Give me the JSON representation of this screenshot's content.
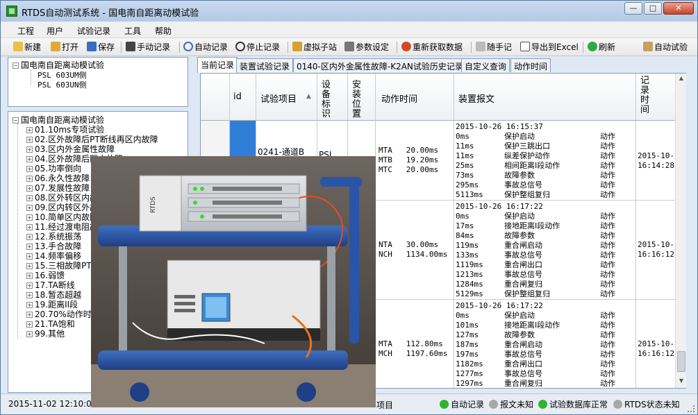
{
  "window": {
    "title": "RTDS自动测试系统 - 国电南自距离动模试验",
    "buttons": [
      "—",
      "□",
      "✕"
    ]
  },
  "menu": [
    "工程",
    "用户",
    "试验记录",
    "工具",
    "帮助"
  ],
  "toolbar": {
    "new": "新建",
    "open": "打开",
    "save": "保存",
    "manual_record": "手动记录",
    "auto_record": "自动记录",
    "stop_record": "停止记录",
    "virtual_station": "虚拟子站",
    "param_settings": "参数设定",
    "refetch_data": "重新获取数据",
    "notes": "随手记",
    "export_excel": "导出到Excel",
    "refresh": "刷新",
    "auto_test": "自动试验"
  },
  "project_tree": {
    "root": "国电南自距离动模试验",
    "children": [
      "PSL 603UM侧",
      "PSL 603UN侧"
    ]
  },
  "test_tree": {
    "root": "国电南自距离动模试验",
    "items": [
      "01.10ms专项试验",
      "02.区外故障后PT断线再区内故障",
      "03.区内外金属性故障",
      "04.区外故障后区内故障",
      "05.功率倒向",
      "06.永久性故障",
      "07.发展性故障",
      "08.区外转区内故障",
      "09.区内转区外故障",
      "10.简单区内故障",
      "11.经过渡电阻故障",
      "12.系统振荡",
      "13.手合故障",
      "14.频率偏移",
      "15.三相故障PT断线",
      "16.弱馈",
      "17.TA断线",
      "18.暂态超越",
      "19.距离II段",
      "20.70%动作时间",
      "21.TA饱和",
      "99.其他"
    ]
  },
  "tabs": [
    "当前记录",
    "装置试验记录",
    "0140-区内外金属性故障-K2AN试验历史记录",
    "自定义查询",
    "动作时间"
  ],
  "grid": {
    "headers": {
      "id": "id",
      "test_item": "试验项目",
      "device_id": "设备标识",
      "install_pos": "安装位置",
      "action_time": "动作时间",
      "device_msg": "装置报文",
      "record_time": "记录时间"
    },
    "rows": [
      {
        "test_item": "0241-通道B",
        "device_id": "PSL",
        "action_time": "MTA   20.00ms\nMTB   19.20ms\nMTC   20.00ms",
        "message_times": "2015-10-26 16:15:37\n0ms\n11ms\n11ms\n25ms\n73ms\n295ms\n5113ms",
        "message_texts": "\n保护启动\n保护三跳出口\n纵差保护动作\n相间距离Ⅰ段动作\n故障参数\n事故总信号\n保护整组复归",
        "message_states": "\n动作\n动作\n动作\n动作\n动作\n动作\n动作",
        "record_time": "2015-10-26\n16:14:28"
      },
      {
        "test_item": "",
        "device_id": "",
        "action_time": "NTA   30.00ms\nNCH   1134.00ms",
        "message_times": "2015-10-26 16:17:22\n0ms\n17ms\n84ms\n119ms\n133ms\n1119ms\n1213ms\n1284ms\n5129ms",
        "message_texts": "\n保护启动\n接地距离Ⅰ段动作\n故障参数\n重合闸启动\n事故总信号\n重合闸出口\n事故总信号\n重合闸复归\n保护整组复归",
        "message_states": "\n动作\n动作\n动作\n动作\n动作\n动作\n动作\n动作\n动作",
        "record_time": "2015-10-26\n16:16:12"
      },
      {
        "test_item": "",
        "device_id": "",
        "action_time": "MTA   112.80ms\nMCH   1197.60ms",
        "message_times": "2015-10-26 16:17:22\n0ms\n101ms\n127ms\n187ms\n197ms\n1182ms\n1277ms\n1297ms",
        "message_texts": "\n保护启动\n接地距离Ⅰ段动作\n故障参数\n重合闸启动\n事故总信号\n重合闸出口\n事故总信号\n重合闸复归",
        "message_states": "\n动作\n动作\n动作\n动作\n动作\n动作\n动作\n动作",
        "record_time": "2015-10-26\n16:16:12"
      }
    ]
  },
  "status": {
    "datetime": "2015-11-02 12:10:09",
    "project_suffix": "项目",
    "auto_record": "自动记录",
    "msg_unknown": "报文未知",
    "db_ok": "试验数据库正常",
    "rtds_unknown": "RTDS状态未知",
    "colors": {
      "green": "#2fb52f",
      "gray": "#a8a8a8"
    }
  },
  "photo": {
    "equipment_labels": [
      "RTDS"
    ]
  }
}
